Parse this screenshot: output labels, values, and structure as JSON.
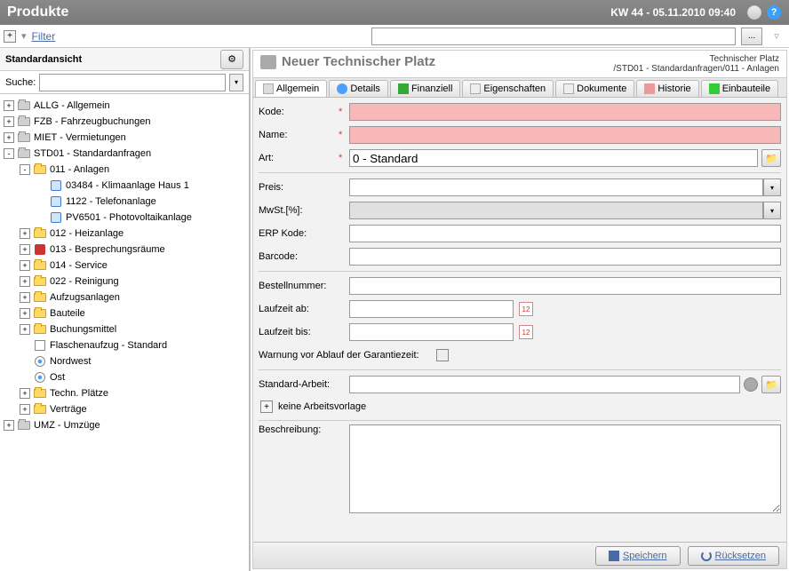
{
  "header": {
    "title": "Produkte",
    "date": "KW 44 - 05.11.2010 09:40"
  },
  "filter": {
    "label": "Filter",
    "btn": "..."
  },
  "sidebar": {
    "title": "Standardansicht",
    "search_label": "Suche:",
    "tree": [
      {
        "indent": 0,
        "exp": "+",
        "icon": "grey",
        "label": "ALLG - Allgemein"
      },
      {
        "indent": 0,
        "exp": "+",
        "icon": "grey",
        "label": "FZB - Fahrzeugbuchungen"
      },
      {
        "indent": 0,
        "exp": "+",
        "icon": "grey",
        "label": "MIET - Vermietungen"
      },
      {
        "indent": 0,
        "exp": "-",
        "icon": "grey",
        "label": "STD01 - Standardanfragen"
      },
      {
        "indent": 1,
        "exp": "-",
        "icon": "yellow",
        "label": "011 - Anlagen"
      },
      {
        "indent": 2,
        "exp": "",
        "icon": "blue",
        "label": "03484 - Klimaanlage Haus 1"
      },
      {
        "indent": 2,
        "exp": "",
        "icon": "blue",
        "label": "1122 - Telefonanlage"
      },
      {
        "indent": 2,
        "exp": "",
        "icon": "blue",
        "label": "PV6501 - Photovoltaikanlage"
      },
      {
        "indent": 1,
        "exp": "+",
        "icon": "yellow",
        "label": "012 - Heizanlage"
      },
      {
        "indent": 1,
        "exp": "+",
        "icon": "red",
        "label": "013 - Besprechungsräume"
      },
      {
        "indent": 1,
        "exp": "+",
        "icon": "yellow",
        "label": "014 - Service"
      },
      {
        "indent": 1,
        "exp": "+",
        "icon": "yellow",
        "label": "022 - Reinigung"
      },
      {
        "indent": 1,
        "exp": "+",
        "icon": "yellow",
        "label": "Aufzugsanlagen"
      },
      {
        "indent": 1,
        "exp": "+",
        "icon": "yellow",
        "label": "Bauteile"
      },
      {
        "indent": 1,
        "exp": "+",
        "icon": "yellow",
        "label": "Buchungsmittel"
      },
      {
        "indent": 1,
        "exp": "",
        "icon": "chart",
        "label": "Flaschenaufzug - Standard"
      },
      {
        "indent": 1,
        "exp": "",
        "icon": "target",
        "label": "Nordwest"
      },
      {
        "indent": 1,
        "exp": "",
        "icon": "target",
        "label": "Ost"
      },
      {
        "indent": 1,
        "exp": "+",
        "icon": "yellow",
        "label": "Techn. Plätze"
      },
      {
        "indent": 1,
        "exp": "+",
        "icon": "yellow",
        "label": "Verträge"
      },
      {
        "indent": 0,
        "exp": "+",
        "icon": "grey",
        "label": "UMZ - Umzüge"
      }
    ]
  },
  "content": {
    "title": "Neuer Technischer Platz",
    "path1": "Technischer Platz",
    "path2": "/STD01 - Standardanfragen/011 - Anlagen",
    "tabs": [
      {
        "label": "Allgemein",
        "active": true,
        "cls": "ti-allg"
      },
      {
        "label": "Details",
        "active": false,
        "cls": "ti-det"
      },
      {
        "label": "Finanziell",
        "active": false,
        "cls": "ti-fin"
      },
      {
        "label": "Eigenschaften",
        "active": false,
        "cls": "ti-eig"
      },
      {
        "label": "Dokumente",
        "active": false,
        "cls": "ti-dok"
      },
      {
        "label": "Historie",
        "active": false,
        "cls": "ti-hist"
      },
      {
        "label": "Einbauteile",
        "active": false,
        "cls": "ti-ein"
      }
    ],
    "form": {
      "kode_label": "Kode:",
      "name_label": "Name:",
      "art_label": "Art:",
      "art_value": "0 - Standard",
      "preis_label": "Preis:",
      "mwst_label": "MwSt.[%]:",
      "erp_label": "ERP Kode:",
      "barcode_label": "Barcode:",
      "bestell_label": "Bestellnummer:",
      "laufzeit_ab_label": "Laufzeit ab:",
      "laufzeit_bis_label": "Laufzeit bis:",
      "warn_label": "Warnung vor Ablauf der Garantiezeit:",
      "std_arbeit_label": "Standard-Arbeit:",
      "keine_vorlage": "keine Arbeitsvorlage",
      "beschreibung_label": "Beschreibung:"
    }
  },
  "footer": {
    "save": "Speichern",
    "reset": "Rücksetzen"
  }
}
